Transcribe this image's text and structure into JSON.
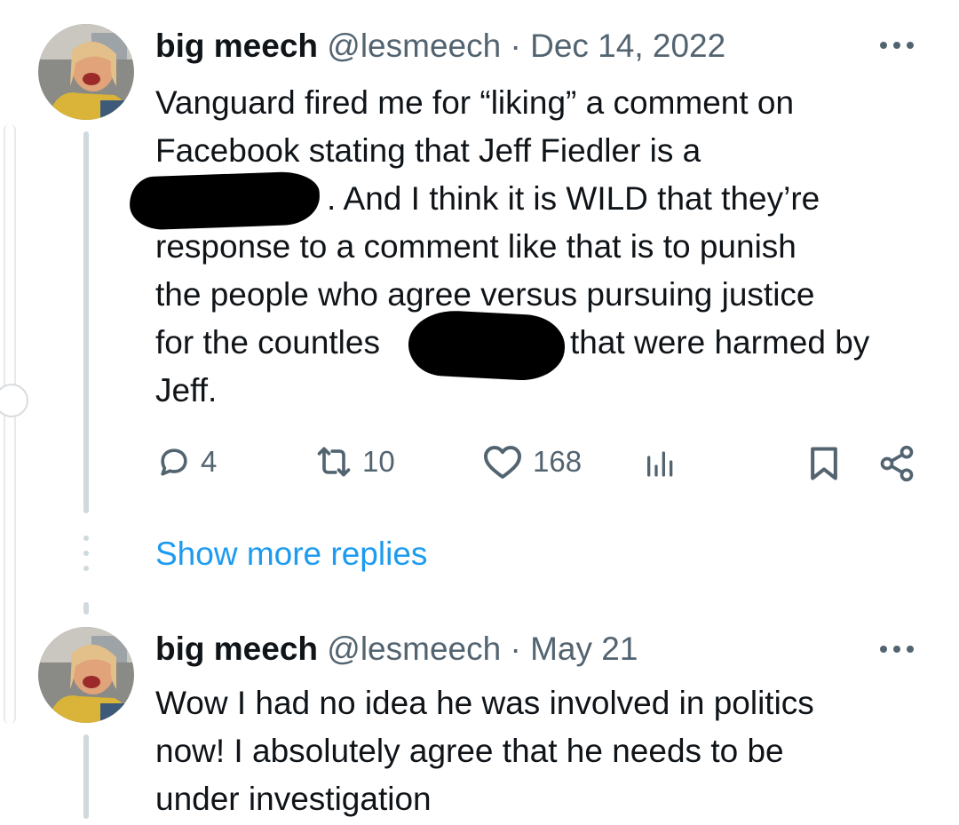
{
  "tweets": [
    {
      "display_name": "big meech",
      "handle": "@lesmeech",
      "separator": "·",
      "date": "Dec 14, 2022",
      "text_lines": [
        "Vanguard fired me for “liking” a comment on",
        "Facebook stating that Jeff Fiedler is a",
        ". And I think it is WILD that they’re",
        "response to a comment like that is to punish",
        "the people who agree versus pursuing justice",
        "for the countles",
        "that were harmed by",
        "Jeff."
      ],
      "actions": {
        "replies": "4",
        "retweets": "10",
        "likes": "168"
      },
      "more_icon": "more-horizontal-icon"
    },
    {
      "display_name": "big meech",
      "handle": "@lesmeech",
      "separator": "·",
      "date": "May 21",
      "text_lines": [
        "Wow I had no idea he was involved in politics",
        "now! I absolutely agree that he needs to be",
        "under investigation"
      ],
      "more_icon": "more-horizontal-icon"
    }
  ],
  "show_more_replies": "Show more replies",
  "icons": [
    "reply-icon",
    "retweet-icon",
    "like-icon",
    "analytics-icon",
    "bookmark-icon",
    "share-icon"
  ],
  "colors": {
    "text": "#0f1419",
    "secondary": "#536471",
    "link": "#1d9bf0",
    "thread_line": "#cfd9de",
    "redaction": "#000000"
  }
}
